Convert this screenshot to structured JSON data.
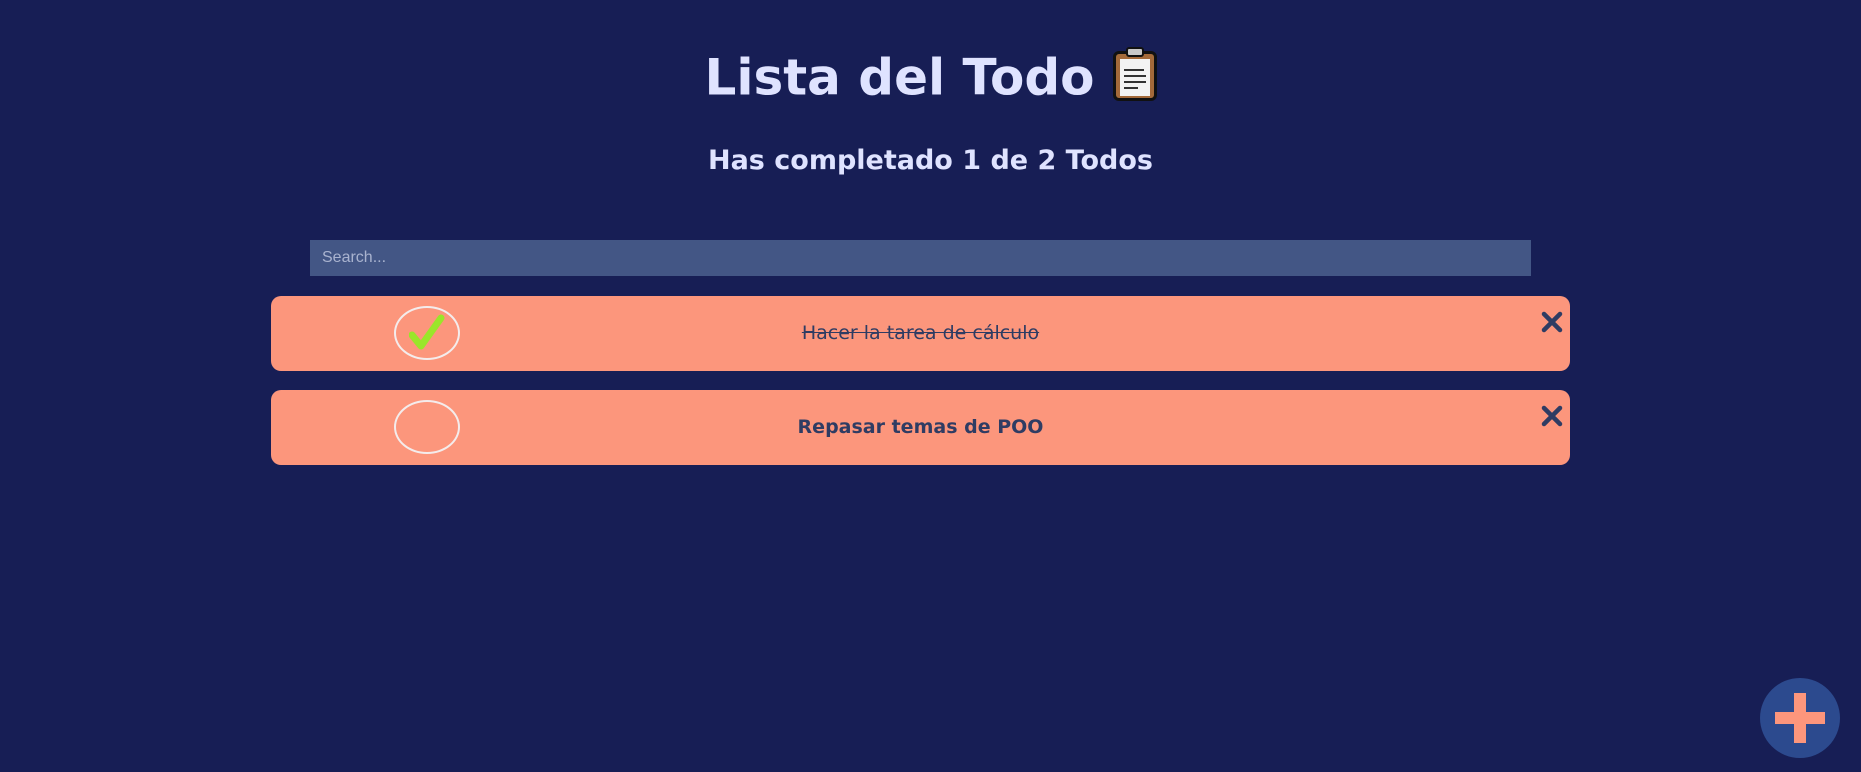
{
  "header": {
    "title": "Lista del Todo",
    "title_icon": "clipboard-icon",
    "counter_text": "Has completado 1 de 2 Todos"
  },
  "search": {
    "placeholder": "Search...",
    "value": ""
  },
  "todos": [
    {
      "text": "Hacer la tarea de cálculo",
      "completed": true
    },
    {
      "text": "Repasar temas de POO",
      "completed": false
    }
  ],
  "icons": {
    "check": "check-icon",
    "delete": "close-icon",
    "add": "plus-icon"
  },
  "colors": {
    "background": "#171e55",
    "card": "#fc967c",
    "text_dark": "#2f3c63",
    "heading": "#dfe3ff",
    "search_bg": "#435685",
    "check": "#9ae62a",
    "fab": "#2c4a8e"
  }
}
